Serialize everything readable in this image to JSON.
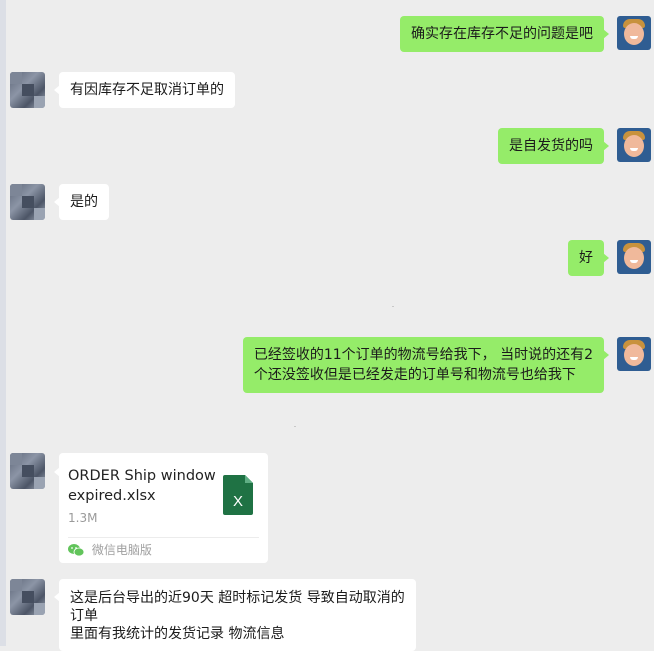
{
  "messages": [
    {
      "from": "me",
      "text": "确实存在库存不足的问题是吧"
    },
    {
      "from": "them",
      "text": "有因库存不足取消订单的"
    },
    {
      "from": "me",
      "text": "是自发货的吗"
    },
    {
      "from": "them",
      "text": "是的"
    },
    {
      "from": "me",
      "text": "好"
    },
    {
      "from": "me",
      "lines": [
        "已经签收的11个订单的物流号给我下， 当时说的还有2",
        "个还没签收但是已经发走的订单号和物流号也给我下"
      ]
    },
    {
      "from": "them",
      "type": "file",
      "file_name": "ORDER Ship window expired.xlsx",
      "file_size": "1.3M",
      "file_icon": "excel-icon",
      "source": "微信电脑版"
    },
    {
      "from": "them",
      "lines": [
        "这是后台导出的近90天 超时标记发货  导致自动取消的",
        "订单",
        "里面有我统计的发货记录 物流信息"
      ]
    }
  ],
  "colors": {
    "my_bubble": "#95ec69",
    "their_bubble": "#ffffff",
    "background": "#ededed",
    "excel_green": "#1f7244"
  }
}
